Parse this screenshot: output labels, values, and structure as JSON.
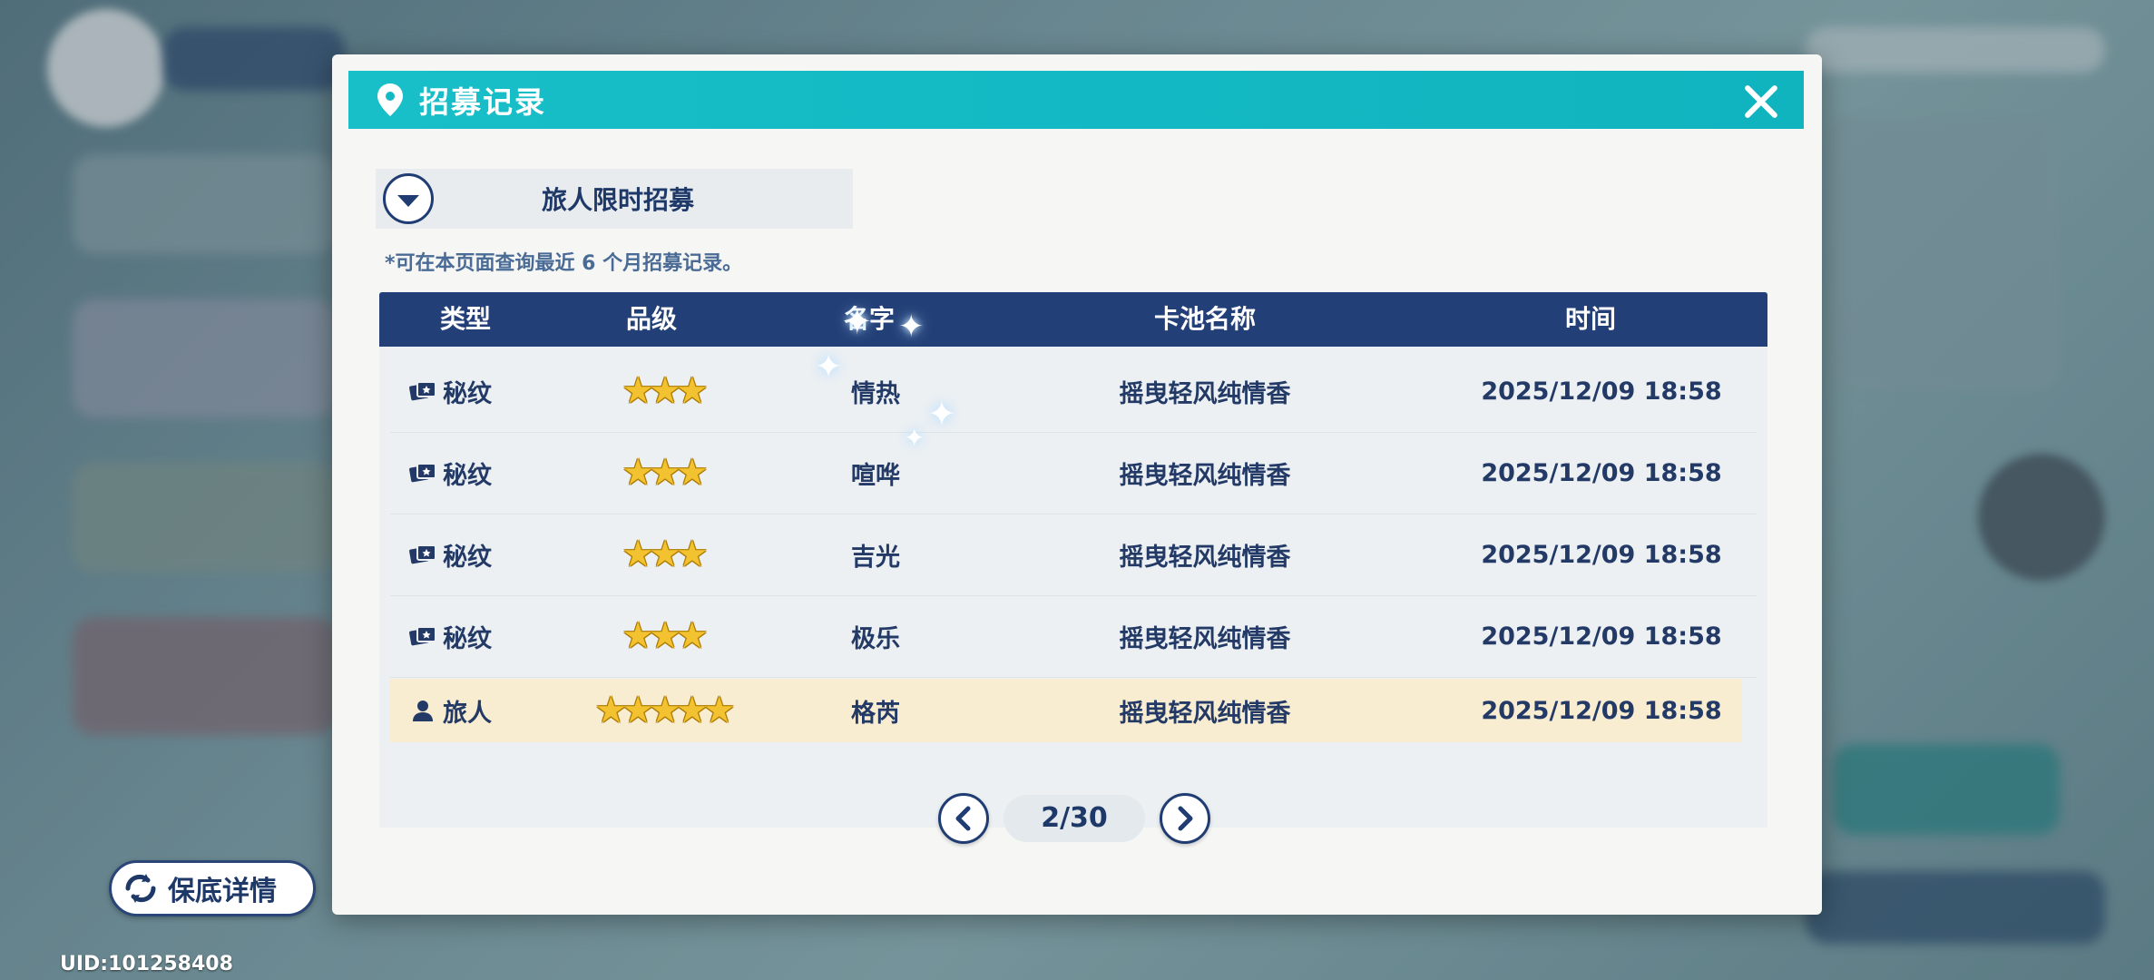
{
  "dialog": {
    "title": "招募记录",
    "pool_name": "旅人限时招募",
    "note": "*可在本页面查询最近 6 个月招募记录。"
  },
  "table": {
    "headers": [
      "类型",
      "品级",
      "名字",
      "卡池名称",
      "时间"
    ],
    "rows": [
      {
        "type": "秘纹",
        "type_icon": "rune-card-icon",
        "stars": 3,
        "name": "情热",
        "pool": "摇曳轻风纯情香",
        "time": "2025/12/09 18:58"
      },
      {
        "type": "秘纹",
        "type_icon": "rune-card-icon",
        "stars": 3,
        "name": "喧哗",
        "pool": "摇曳轻风纯情香",
        "time": "2025/12/09 18:58"
      },
      {
        "type": "秘纹",
        "type_icon": "rune-card-icon",
        "stars": 3,
        "name": "吉光",
        "pool": "摇曳轻风纯情香",
        "time": "2025/12/09 18:58"
      },
      {
        "type": "秘纹",
        "type_icon": "rune-card-icon",
        "stars": 3,
        "name": "极乐",
        "pool": "摇曳轻风纯情香",
        "time": "2025/12/09 18:58"
      },
      {
        "type": "旅人",
        "type_icon": "person-icon",
        "stars": 5,
        "name": "格芮",
        "pool": "摇曳轻风纯情香",
        "time": "2025/12/09 18:58",
        "highlight": true
      }
    ]
  },
  "pager": {
    "label": "2/30"
  },
  "footer": {
    "guarantee_label": "保底详情",
    "uid": "UID:101258408"
  },
  "colors": {
    "title_bar": "#12b8c3",
    "header_bg": "#233f77",
    "text_dark": "#1e3868",
    "highlight_row": "#f8ecd1",
    "star": "#f2c230"
  }
}
